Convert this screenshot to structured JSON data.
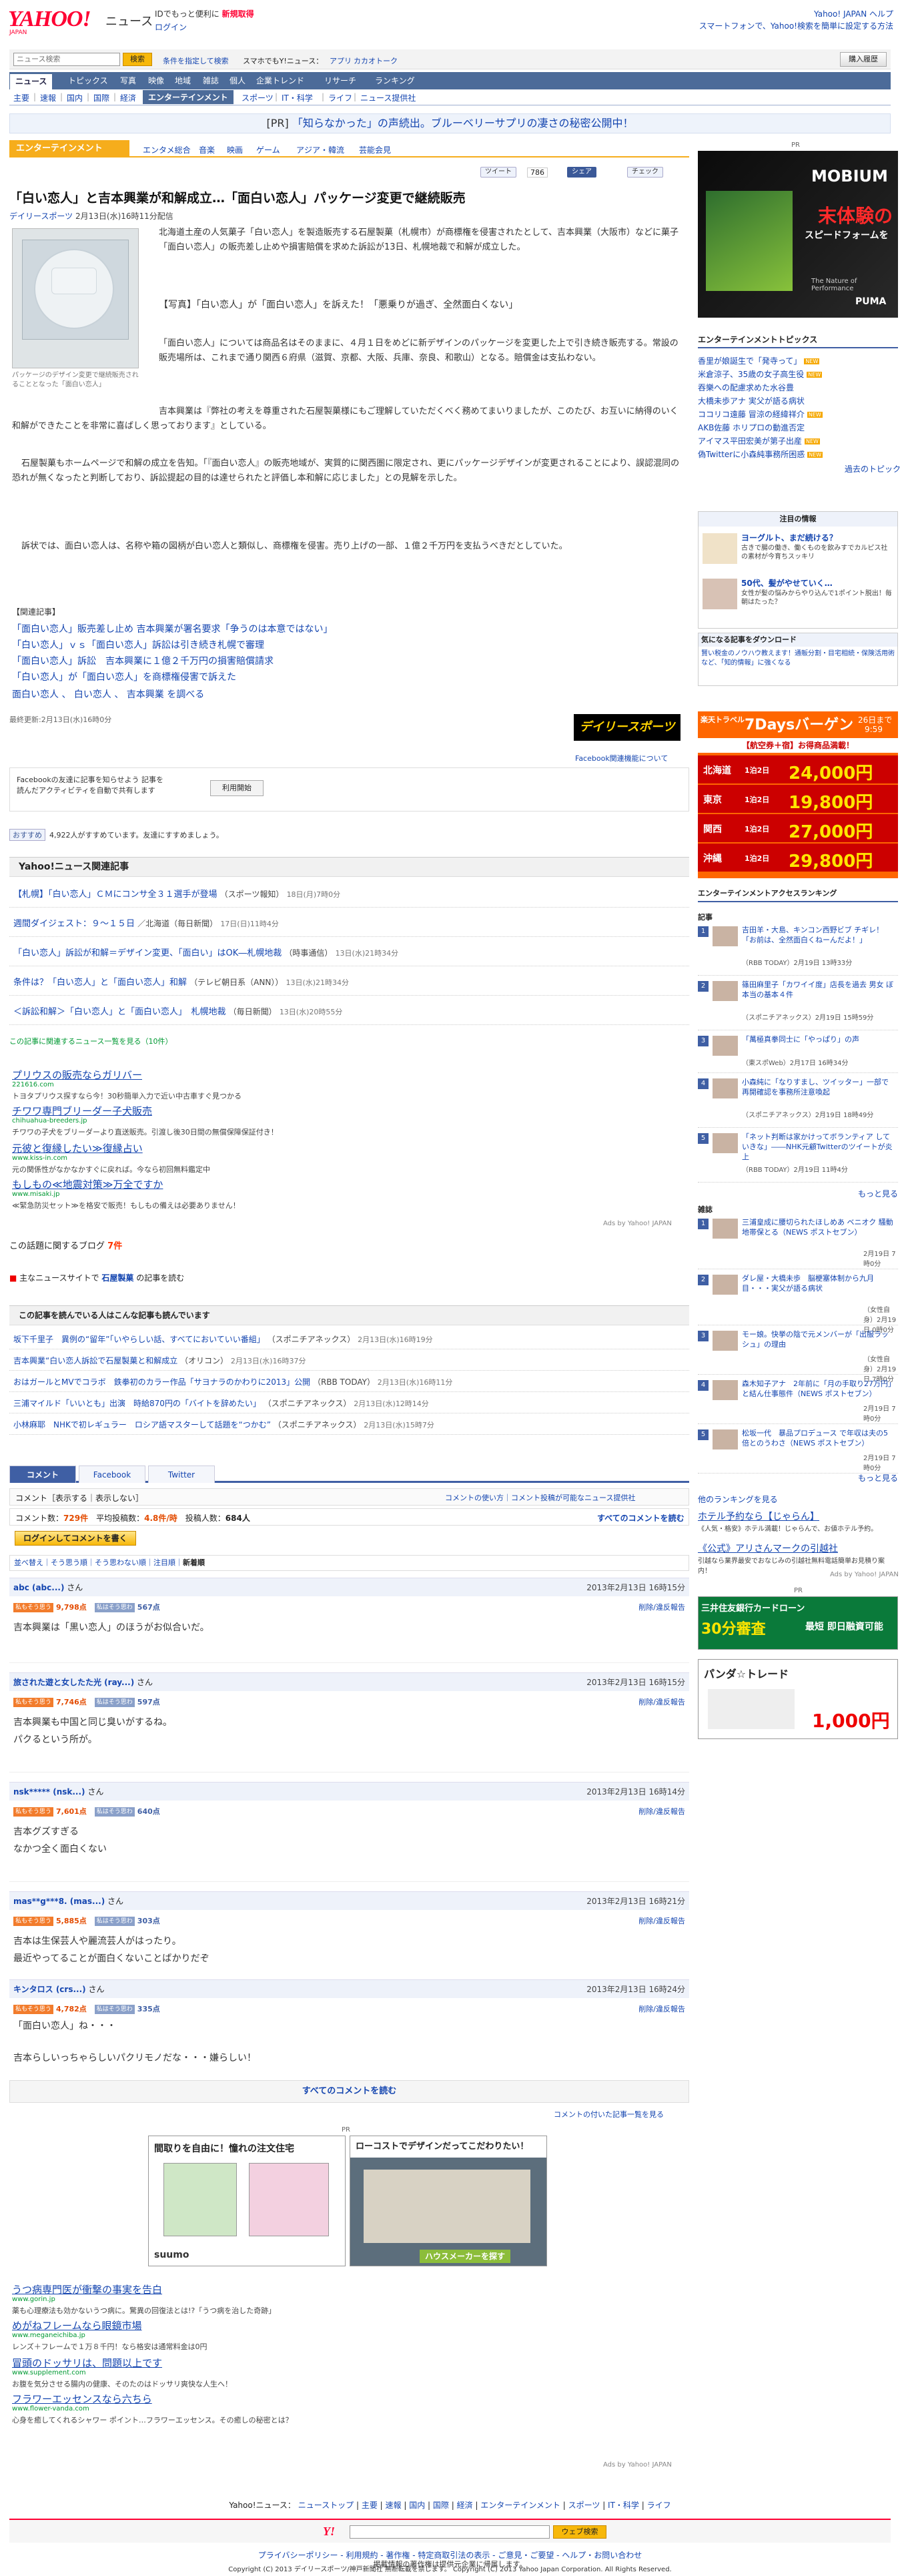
{
  "header": {
    "logo": "YAHOO!",
    "logo_sub": "JAPAN",
    "section": "ニュース",
    "promo_pre": "IDでもっと便利に",
    "promo_link": "新規取得",
    "login": "ログイン",
    "right_links": "Yahoo! JAPAN ヘルプ",
    "right_links2": "スマートフォンで、Yahoo!検索を簡単に設定する方法"
  },
  "search": {
    "placeholder": "ニュース検索",
    "button": "検索",
    "opt1": "条件を指定して検索",
    "opt2": "スマホでもY!ニュース：",
    "opt3": "アプリ",
    "opt4": "カカオトーク",
    "buy": "購入履歴"
  },
  "main_nav": [
    "ニュース",
    "トピックス",
    "写真",
    "映像",
    "地域",
    "雑誌",
    "個人",
    "企業トレンド",
    "リサーチ",
    "ランキング"
  ],
  "sub_nav": [
    "主要",
    "速報",
    "国内",
    "国際",
    "経済",
    "エンターテインメント",
    "スポーツ",
    "IT・科学",
    "ライフ",
    "ニュース提供社"
  ],
  "pr_bar": {
    "label": "[PR]",
    "text": "「知らなかった」の声続出。ブルーベリーサプリの凄さの秘密公開中！"
  },
  "category": {
    "label": "エンターテインメント",
    "links": [
      "エンタメ総合",
      "音楽",
      "映画",
      "ゲーム",
      "アジア・韓流",
      "芸能会見"
    ]
  },
  "share": {
    "tweet": "ツイート",
    "tweet_count": "786",
    "fb_share": "シェア",
    "check": "チェック"
  },
  "article": {
    "title": "「白い恋人」と吉本興業が和解成立…「面白い恋人」パッケージ変更で継続販売",
    "source": "デイリースポーツ",
    "date": "2月13日(水)16時11分配信",
    "caption": "パッケージのデザイン変更で継続販売されることとなった「面白い恋人」",
    "p1": "北海道土産の人気菓子「白い恋人」を製造販売する石屋製菓（札幌市）が商標権を侵害されたとして、吉本興業（大阪市）などに菓子「面白い恋人」の販売差し止めや損害賠償を求めた訴訟が13日、札幌地裁で和解が成立した。",
    "photo_link": "【写真】「白い恋人」が「面白い恋人」を訴えた！「悪乗りが過ぎ、全然面白くない」",
    "p2": "「面白い恋人」については商品名はそのままに、４月１日をめどに新デザインのパッケージを変更した上で引き続き販売する。常設の販売場所は、これまで通り関西６府県（滋賀、京都、大阪、兵庫、奈良、和歌山）となる。賠償金は支払わない。",
    "p3": "吉本興業は『弊社の考えを尊重された石屋製菓様にもご理解していただくべく務めてまいりましたが、このたび、お互いに納得のいく和解ができたことを非常に喜ばしく思っております』としている。",
    "p4": "石屋製菓もホームページで和解の成立を告知。「『面白い恋人』の販売地域が、実質的に関西圏に限定され、更にパッケージデザインが変更されることにより、誤認混同の恐れが無くなったと判断しており、訴訟提起の目的は達せられたと評価し本和解に応じました」との見解を示した。",
    "p5": "訴状では、面白い恋人は、名称や箱の図柄が白い恋人と類似し、商標権を侵害。売り上げの一部、１億２千万円を支払うべきだとしていた。",
    "related_head": "【関連記事】",
    "related": [
      "「面白い恋人」販売差し止め 吉本興業が署名要求「争うのは本意ではない」",
      "「白い恋人」ｖｓ「面白い恋人」訴訟は引き続き札幌で審理",
      "「面白い恋人」訴訟　吉本興業に１億２千万円の損害賠償請求",
      "「白い恋人」が「面白い恋人」を商標権侵害で訴えた"
    ],
    "keywords": "面白い恋人 、 白い恋人 、 吉本興業 を調べる",
    "updated": "最終更新:2月13日(水)16時0分",
    "daily_logo": "デイリースポーツ",
    "daily_link": "Facebook関連機能について"
  },
  "facebook": {
    "text": "Facebookの友達に記事を知らせよう 記事を読んだアクティビティを自動で共有します",
    "button": "利用開始",
    "like": "おすすめ",
    "like_text": "4,922人がすすめています。友達にすすめましょう。"
  },
  "related_news": {
    "head": "Yahoo!ニュース関連記事",
    "items": [
      {
        "title": "【札幌】「白い恋人」ＣＭにコンサ全３１選手が登場",
        "src": "（スポーツ報知）",
        "dt": "18日(月)7時0分"
      },
      {
        "title": "週間ダイジェスト：９～１５日",
        "src": "／北海道（毎日新聞）",
        "dt": "17日(日)11時4分"
      },
      {
        "title": "「白い恋人」訴訟が和解＝デザイン変更、「面白い」はOK―札幌地裁",
        "src": "（時事通信）",
        "dt": "13日(水)21時34分"
      },
      {
        "title": "条件は？「白い恋人」と「面白い恋人」和解",
        "src": "（テレビ朝日系（ANN））",
        "dt": "13日(水)21時34分"
      },
      {
        "title": "＜訴訟和解＞「白い恋人」と「面白い恋人」　札幌地裁",
        "src": "（毎日新聞）",
        "dt": "13日(水)20時55分"
      }
    ],
    "more": "この記事に関連するニュース一覧を見る（10件）"
  },
  "ads1": [
    {
      "title": "プリウスの販売ならガリバー",
      "url": "221616.com",
      "desc": "トヨタプリウス探すなら今！30秒簡単入力で近い中古車すぐ見つかる"
    },
    {
      "title": "チワワ専門ブリーダー子犬販売",
      "url": "chihuahua-breeders.jp",
      "desc": "チワワの子犬をブリーダーより直送販売。引渡し後30日間の無償保障保証付き！"
    },
    {
      "title": "元彼と復縁したい≫復縁占い",
      "url": "www.kiss-in.com",
      "desc": "元の関係性がなかなかすぐに戻れば。今なら初回無料鑑定中"
    },
    {
      "title": "もしもの≪地震対策≫万全ですか",
      "url": "www.misaki.jp",
      "desc": "≪緊急防災セット≫を格安で販売！もしもの備えは必要ありません！"
    }
  ],
  "ads_by": "Ads by Yahoo! JAPAN",
  "blogs": {
    "pre": "この話題に関するブログ",
    "count": "7件"
  },
  "kw_row": {
    "pre": "主なニュースサイトで",
    "kw": "石屋製菓",
    "post": "の記事を読む"
  },
  "also_read": {
    "head": "この記事を読んでいる人はこんな記事も読んでいます",
    "items": [
      {
        "title": "坂下千里子　異例の“留年”「いやらしい話、すべてにおいていい番組」",
        "src": "（スポニチアネックス）",
        "dt": "2月13日(水)16時19分"
      },
      {
        "title": "吉本興業“白い恋人訴訟で石屋製菓と和解成立",
        "src": "（オリコン）",
        "dt": "2月13日(水)16時37分"
      },
      {
        "title": "おはガールとMVでコラボ　鉄拳初のカラー作品「サヨナラのかわりに2013」公開",
        "src": "（RBB TODAY）",
        "dt": "2月13日(水)16時11分"
      },
      {
        "title": "三浦マイルド「いいとも」出演　時給870円の「バイトを辞めたい」",
        "src": "（スポニチアネックス）",
        "dt": "2月13日(水)12時14分"
      },
      {
        "title": "小林麻耶　NHKで初レギュラー　ロシア語マスターして話題を“つかむ”",
        "src": "（スポニチアネックス）",
        "dt": "2月13日(水)15時7分"
      }
    ]
  },
  "comments": {
    "tabs": [
      "コメント",
      "Facebook",
      "Twitter"
    ],
    "show_label": "コメント［表示する｜表示しない］",
    "right_links": "コメントの使い方｜コメント投稿が可能なニュース提供社",
    "count_label": "コメント数：",
    "count": "729件",
    "avg_label": "平均投稿数：",
    "avg": "4.8件/時",
    "posters_label": "投稿人数：",
    "posters": "684人",
    "all_link": "すべてのコメントを読む",
    "write": "ログインしてコメントを書く",
    "sort": "並べ替え｜そう思う順｜そう思わない順｜注目順｜",
    "sort_active": "新着順",
    "agree": "私もそう思う",
    "disagree": "私はそう思わない",
    "delete": "削除/違反報告",
    "list": [
      {
        "name": "abc (abc...)",
        "san": "さん",
        "date": "2013年2月13日 16時15分",
        "agree": "9,798点",
        "disagree": "567点",
        "text": "吉本興業は「黒い恋人」のほうがお似合いだ。"
      },
      {
        "name": "旅された遊と女したた光 (ray...)",
        "san": "さん",
        "date": "2013年2月13日 16時15分",
        "agree": "7,746点",
        "disagree": "597点",
        "text": "吉本興業も中国と同じ臭いがするね。\nパクるという所が。"
      },
      {
        "name": "nsk***** (nsk...)",
        "san": "さん",
        "date": "2013年2月13日 16時14分",
        "agree": "7,601点",
        "disagree": "640点",
        "text": "吉本グズすぎる\nなかつ全く面白くない"
      },
      {
        "name": "mas**g***8. (mas...)",
        "san": "さん",
        "date": "2013年2月13日 16時21分",
        "agree": "5,885点",
        "disagree": "303点",
        "text": "吉本は生保芸人や麗流芸人がはったり。\n最近やってることが面白くないことばかりだぞ"
      },
      {
        "name": "キンタロス (crs...)",
        "san": "さん",
        "date": "2013年2月13日 16時24分",
        "agree": "4,782点",
        "disagree": "335点",
        "text": "「面白い恋人」ね・・・\n\n吉本らしいっちゃらしいパクリモノだな・・・嫌らしい！"
      }
    ],
    "read_all": "すべてのコメントを読む",
    "list_link": "コメントの付いた記事一覧を見る"
  },
  "bottom_pr": "PR",
  "bottom_ad1": {
    "title": "間取りを自由に！憧れの注文住宅",
    "brand": "suumo"
  },
  "bottom_ad2": {
    "title": "ローコストでデザインだってこだわりたい！",
    "btn": "ハウスメーカーを探す"
  },
  "ads2": [
    {
      "title": "うつ病専門医が衝撃の事実を告白",
      "url": "www.gorin.jp",
      "desc": "薬も心理療法も効かないうつ病に。驚異の回復法とは!?「うつ病を治した奇跡」"
    },
    {
      "title": "めがねフレームなら眼鏡市場",
      "url": "www.meganeichiba.jp",
      "desc": "レンズ＋フレームで１万８千円！なら格安は通常料金は0円"
    },
    {
      "title": "冒頭のドッサリは、問題以上です",
      "url": "www.supplement.com",
      "desc": "お腹を気分させる腸内の健康、そのたのはドッサリ爽快な人生へ！"
    },
    {
      "title": "フラワーエッセンスなら六ちら",
      "url": "www.flower-vanda.com",
      "desc": "心身を癒してくれるシャワー ポイント…フラワーエッセンス。その癒しの秘密とは？"
    }
  ],
  "footer": {
    "nav_label": "Yahoo!ニュース：",
    "nav": [
      "ニューストップ",
      "主要",
      "速報",
      "国内",
      "国際",
      "経済",
      "エンターテインメント",
      "スポーツ",
      "IT・科学",
      "ライフ"
    ],
    "search_btn": "ウェブ検索",
    "line1": "プライバシーポリシー - 利用規約 - 著作権 - 特定商取引法の表示 - ご意見・ご要望 - ヘルプ・お問い合わせ",
    "line2": "掲載情報の著作権は提供元企業に帰属します。",
    "line3": "Copyright (C) 2013 デイリースポーツ/神戸新聞社 無断転載を禁じます。",
    "line4": "Copyright (C) 2013 Yahoo Japan Corporation. All Rights Reserved."
  },
  "side": {
    "pr": "PR",
    "ad1": {
      "brand": "MOBIUM",
      "tag": "末体験の",
      "tag2": "スピードフォームを",
      "bottom": "The Nature of Performance",
      "logo": "PUMA"
    },
    "topics_head": "エンターテインメントトピックス",
    "topics": [
      "香里が娘誕生で「発寺って」",
      "米倉涼子、35歳の女子高生役",
      "吞樂への配慮求めた水谷豊",
      "大橋未歩アナ 実父が語る病状",
      "ココリコ遠藤 冒涼の経緯祥介",
      "AKB佐藤 ホリプロの動進否定",
      "アイマス平田宏美が第子出産",
      "偽Twitterに小森純事務所困惑"
    ],
    "topics_more": "過去のトピックス",
    "hot_head": "注目の情報",
    "hot": [
      {
        "title": "ヨーグルト、まだ続ける？",
        "desc": "古きで腸の働き、働くものを飲みすでカルピス社の素材が今育ちスッキリ"
      },
      {
        "title": "50代、髪がやせていく…",
        "desc": "女性が髪の悩みからやり込んで1ポイント脱出！毎朝はたった？"
      }
    ],
    "recent_head": "気になる記事をダウンロード",
    "recent_text": "賢い税金のノウハウ教えます！通販分割・目宅相続・保険活用術など、「知的情報」に強くなる",
    "ad2": {
      "line1": "楽天トラベル",
      "line2": "7Daysバーゲン",
      "date": "26日まで",
      "time": "9:59",
      "sub": "【航空券＋宿】お得商品満載！",
      "rows": [
        {
          "area": "北海道",
          "price": "24,000円"
        },
        {
          "area": "東京",
          "price": "19,800円"
        },
        {
          "area": "関西",
          "price": "27,000円"
        },
        {
          "area": "沖縄",
          "price": "29,800円"
        }
      ],
      "per": "1泊2日"
    },
    "access_head": "エンターテインメントアクセスランキング",
    "news_label": "記事",
    "rank": [
      {
        "n": "1",
        "t": "吉田羊・大島、キンコン西野ビブ チギレ！「お前は、全然面白くねーんだよ！」",
        "m": "（RBB TODAY）2月19日 13時33分"
      },
      {
        "n": "2",
        "t": "篠田麻里子「カワイイ度」店長を過去 男女 ぼ本当の基本４件",
        "m": "（スポニチアネックス）2月19日 15時59分"
      },
      {
        "n": "3",
        "t": "「萬極真拳同士に「やっぱり」の声",
        "m": "（東スポWeb）2月17日 16時34分"
      },
      {
        "n": "4",
        "t": "小森純に「なりすまし、ツイッター」一部で再開確認を事務所注意喚起",
        "m": "（スポニチアネックス）2月19日 18時49分"
      },
      {
        "n": "5",
        "t": "「ネット判断は家かけってボランティア していきな」――NHK元顧Twitterのツイートが炎上",
        "m": "（RBB TODAY）2月19日 11時4分"
      }
    ],
    "rank_more": "もっと見る",
    "mag_label": "雑誌",
    "rank2": [
      {
        "n": "1",
        "t": "三浦皇成に腰切られたほしめあ ベニオク 騒動地帯保とる（NEWS ポストセブン）",
        "m": "2月19日 7時0分"
      },
      {
        "n": "2",
        "t": "ダレ屋・大橋未歩　脳梗塞体制から九月目・・・実父が語る病状",
        "m": "（女性自身）2月19日 0時0分"
      },
      {
        "n": "3",
        "t": "モー娘。快挙の陰で元メンバーが「出服ラッシュ」の理由",
        "m": "（女性自身）2月19日 7時0分"
      },
      {
        "n": "4",
        "t": "森木知子アナ　2年前に「月の手取り27万円」と結ん仕事態件（NEWS ポストセブン）",
        "m": "2月19日 7時0分"
      },
      {
        "n": "5",
        "t": "松坂一代　暴品プロデュース で年収は夫の5倍とのうわさ（NEWS ポストセブン）",
        "m": "2月19日 7時0分"
      }
    ],
    "rank2_more": "もっと見る",
    "other_rank": "他のランキングを見る",
    "links2": [
      {
        "title": "ホテル予約なら【じゃらん】",
        "desc": "《人気・格安》ホテル満載！じゃらんで、お値ホテル予約。"
      },
      {
        "title": "《公式》アリさんマークの引越社",
        "desc": "引越なら業界最安でおなじみの引越社無料電話簡単お見積り案内！"
      }
    ],
    "ads_by": "Ads by Yahoo! JAPAN",
    "pr2": "PR",
    "ad3": {
      "l1": "三井住友銀行カードローン",
      "l2": "30分審査",
      "l3": "最短 即日融資可能"
    },
    "ad4": {
      "l1": "パンダ☆トレード",
      "l2": "1,000円"
    }
  }
}
